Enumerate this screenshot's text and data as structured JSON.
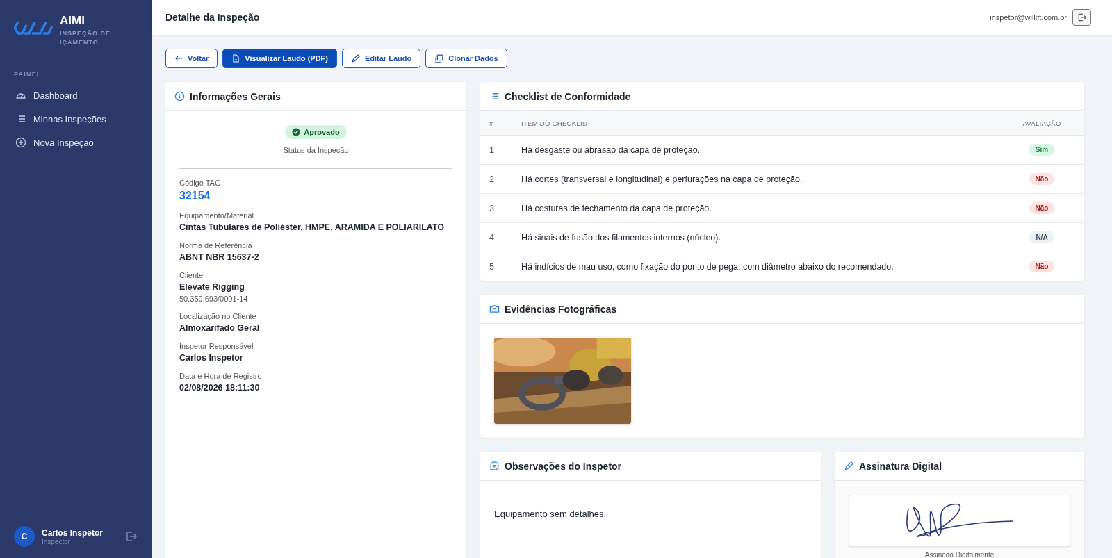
{
  "brand": {
    "name": "AIMI",
    "subtitle": "INSPEÇÃO DE IÇAMENTO"
  },
  "sidebar": {
    "section": "PAINEL",
    "items": [
      {
        "label": "Dashboard",
        "kind": "gauge",
        "selected": false
      },
      {
        "label": "Minhas Inspeções",
        "kind": "list",
        "selected": false
      },
      {
        "label": "Nova Inspeção",
        "kind": "plus",
        "selected": false
      }
    ]
  },
  "user": {
    "initial": "C",
    "name": "Carlos Inspetor",
    "role": "Inspector"
  },
  "header": {
    "title": "Detalhe da Inspeção",
    "email": "inspetor@willift.com.br"
  },
  "actions": [
    {
      "label": "Voltar",
      "kind": "back",
      "primary": false
    },
    {
      "label": "Visualizar Laudo (PDF)",
      "kind": "file",
      "primary": true
    },
    {
      "label": "Editar Laudo",
      "kind": "pencil",
      "primary": false
    },
    {
      "label": "Clonar Dados",
      "kind": "copy",
      "primary": false
    }
  ],
  "general": {
    "title": "Informações Gerais",
    "status": {
      "label": "Aprovado",
      "caption": "Status da Inspeção",
      "kind": "approved"
    },
    "fields": [
      {
        "label": "Código TAG",
        "value": "32154",
        "kind": "tag"
      },
      {
        "label": "Equipamento/Material",
        "value": "Cintas Tubulares de Poliéster, HMPE, ARAMIDA E POLIARILATO"
      },
      {
        "label": "Norma de Referência",
        "value": "ABNT NBR 15637-2"
      },
      {
        "label": "Cliente",
        "value": "Elevate Rigging",
        "extra": "50.359.693/0001-14"
      },
      {
        "label": "Localização no Cliente",
        "value": "Almoxarifado Geral"
      },
      {
        "label": "Inspetor Responsável",
        "value": "Carlos Inspetor"
      },
      {
        "label": "Data e Hora de Registro",
        "value": "02/08/2026 18:11:30"
      }
    ]
  },
  "checklist": {
    "title": "Checklist de Conformidade",
    "columns": [
      "#",
      "ITEM DO CHECKLIST",
      "AVALIAÇÃO"
    ],
    "rows": [
      {
        "number": "1",
        "item": "Há desgaste ou abrasão da capa de proteção.",
        "result": "Sim",
        "kind": "yes"
      },
      {
        "number": "2",
        "item": "Há cortes (transversal e longitudinal) e perfurações na capa de proteção.",
        "result": "Não",
        "kind": "no"
      },
      {
        "number": "3",
        "item": "Há costuras de fechamento da capa de proteção.",
        "result": "Não",
        "kind": "no"
      },
      {
        "number": "4",
        "item": "Há sinais de fusão dos filamentos internos (núcleo).",
        "result": "N/A",
        "kind": "na"
      },
      {
        "number": "5",
        "item": "Há indícios de mau uso, como fixação do ponto de pega, com diâmetro abaixo do recomendado.",
        "result": "Não",
        "kind": "no"
      }
    ]
  },
  "evidence": {
    "title": "Evidências Fotográficas"
  },
  "observations": {
    "title": "Observações do Inspetor",
    "text": "Equipamento sem detalhes."
  },
  "signature": {
    "title": "Assinatura Digital",
    "caption": "Assinado Digitalmente"
  }
}
